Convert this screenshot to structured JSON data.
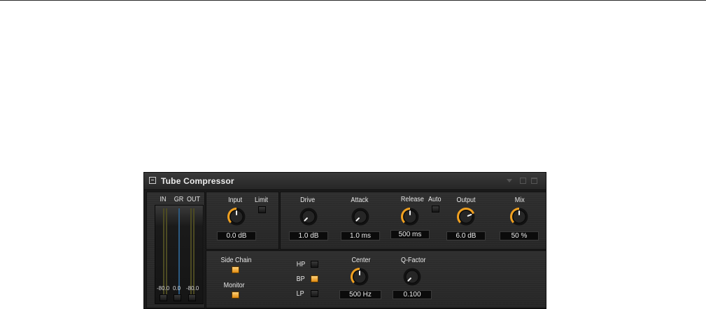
{
  "plugin": {
    "title": "Tube Compressor"
  },
  "meters": {
    "labels": {
      "in": "IN",
      "gr": "GR",
      "out": "OUT"
    },
    "values": {
      "in": "-80.0",
      "gr": "0.0",
      "out": "-80.0"
    }
  },
  "controls": {
    "input": {
      "label": "Input",
      "value": "0.0 dB",
      "level": 0.5
    },
    "limit": {
      "label": "Limit",
      "on": false
    },
    "drive": {
      "label": "Drive",
      "value": "1.0 dB",
      "level": 0.0
    },
    "attack": {
      "label": "Attack",
      "value": "1.0 ms",
      "level": 0.0
    },
    "release": {
      "label": "Release",
      "value": "500 ms",
      "level": 0.5
    },
    "auto": {
      "label": "Auto",
      "on": false
    },
    "output": {
      "label": "Output",
      "value": "6.0 dB",
      "level": 0.75
    },
    "mix": {
      "label": "Mix",
      "value": "50 %",
      "level": 0.5
    }
  },
  "sidechain": {
    "side_chain_label": "Side Chain",
    "side_chain_on": true,
    "monitor_label": "Monitor",
    "monitor_on": true,
    "filters": [
      {
        "label": "HP",
        "on": false
      },
      {
        "label": "BP",
        "on": true
      },
      {
        "label": "LP",
        "on": false
      }
    ],
    "center": {
      "label": "Center",
      "value": "500 Hz",
      "level": 0.5
    },
    "q_factor": {
      "label": "Q-Factor",
      "value": "0.100",
      "level": 0.0
    }
  },
  "colors": {
    "accent": "#f0a020",
    "panel": "#2a2a2a",
    "meter_gr": "#2c5a82",
    "meter_io": "#4c4a22"
  }
}
